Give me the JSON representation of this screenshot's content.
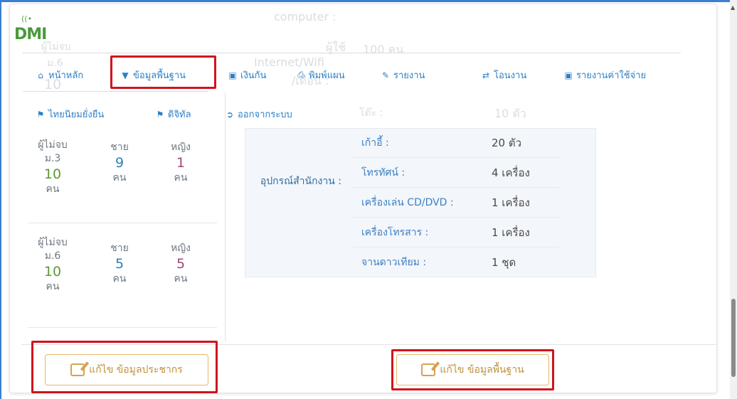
{
  "nav": {
    "items": [
      {
        "label": "หน้าหลัก",
        "icon": "home-icon"
      },
      {
        "label": "ข้อมูลพื้นฐาน",
        "icon": "map-marker-icon"
      },
      {
        "label": "เงินกัน",
        "icon": "money-icon"
      },
      {
        "label": "พิมพ์แผน",
        "icon": "print-icon"
      },
      {
        "label": "รายงาน",
        "icon": "pencil-icon"
      },
      {
        "label": "โอนงาน",
        "icon": "transfer-icon"
      },
      {
        "label": "รายงานค่าใช้จ่าย",
        "icon": "money-icon"
      },
      {
        "label": "ไทยนิยมยั่งยืน",
        "icon": "flag-icon"
      },
      {
        "label": "ดิจิทัล",
        "icon": "flag-icon"
      },
      {
        "label": "ออกจากระบบ",
        "icon": "logout-icon"
      }
    ]
  },
  "logo": {
    "text": "DMI"
  },
  "ghost": {
    "computer": "computer :",
    "user_label": "ผู้ใช้",
    "user_value": "100  คน",
    "internet": "Internet/Wifi",
    "month": "/เดือน :",
    "left_a": "ผู้ไม่จบ",
    "left_b": "ม.6",
    "left_c": "10",
    "table": "โต๊ะ :",
    "table_value": "10  ตัว"
  },
  "stats": [
    {
      "group_label": "ผู้ไม่จบ ม.3",
      "total": "10",
      "total_unit": "คน",
      "male_label": "ชาย",
      "male": "9",
      "male_unit": "คน",
      "female_label": "หญิง",
      "female": "1",
      "female_unit": "คน"
    },
    {
      "group_label": "ผู้ไม่จบ ม.6",
      "total": "10",
      "total_unit": "คน",
      "male_label": "ชาย",
      "male": "5",
      "male_unit": "คน",
      "female_label": "หญิง",
      "female": "5",
      "female_unit": "คน"
    }
  ],
  "equipment": {
    "label": "อุปกรณ์สำนักงาน :",
    "rows": [
      {
        "name": "เก้าอี้ :",
        "value": "20  ตัว"
      },
      {
        "name": "โทรทัศน์ :",
        "value": "4  เครื่อง"
      },
      {
        "name": "เครื่องเล่น CD/DVD :",
        "value": "1  เครื่อง"
      },
      {
        "name": "เครื่องโทรสาร :",
        "value": "1  เครื่อง"
      },
      {
        "name": "จานดาวเทียม :",
        "value": "1  ชุด"
      }
    ]
  },
  "buttons": {
    "edit_population": "แก้ไข ข้อมูลประชากร",
    "edit_basic": "แก้ไข ข้อมูลพื้นฐาน"
  },
  "colors": {
    "highlight": "#d0141c",
    "nav_link": "#2d7fc5",
    "button_border": "#e7b76a"
  }
}
